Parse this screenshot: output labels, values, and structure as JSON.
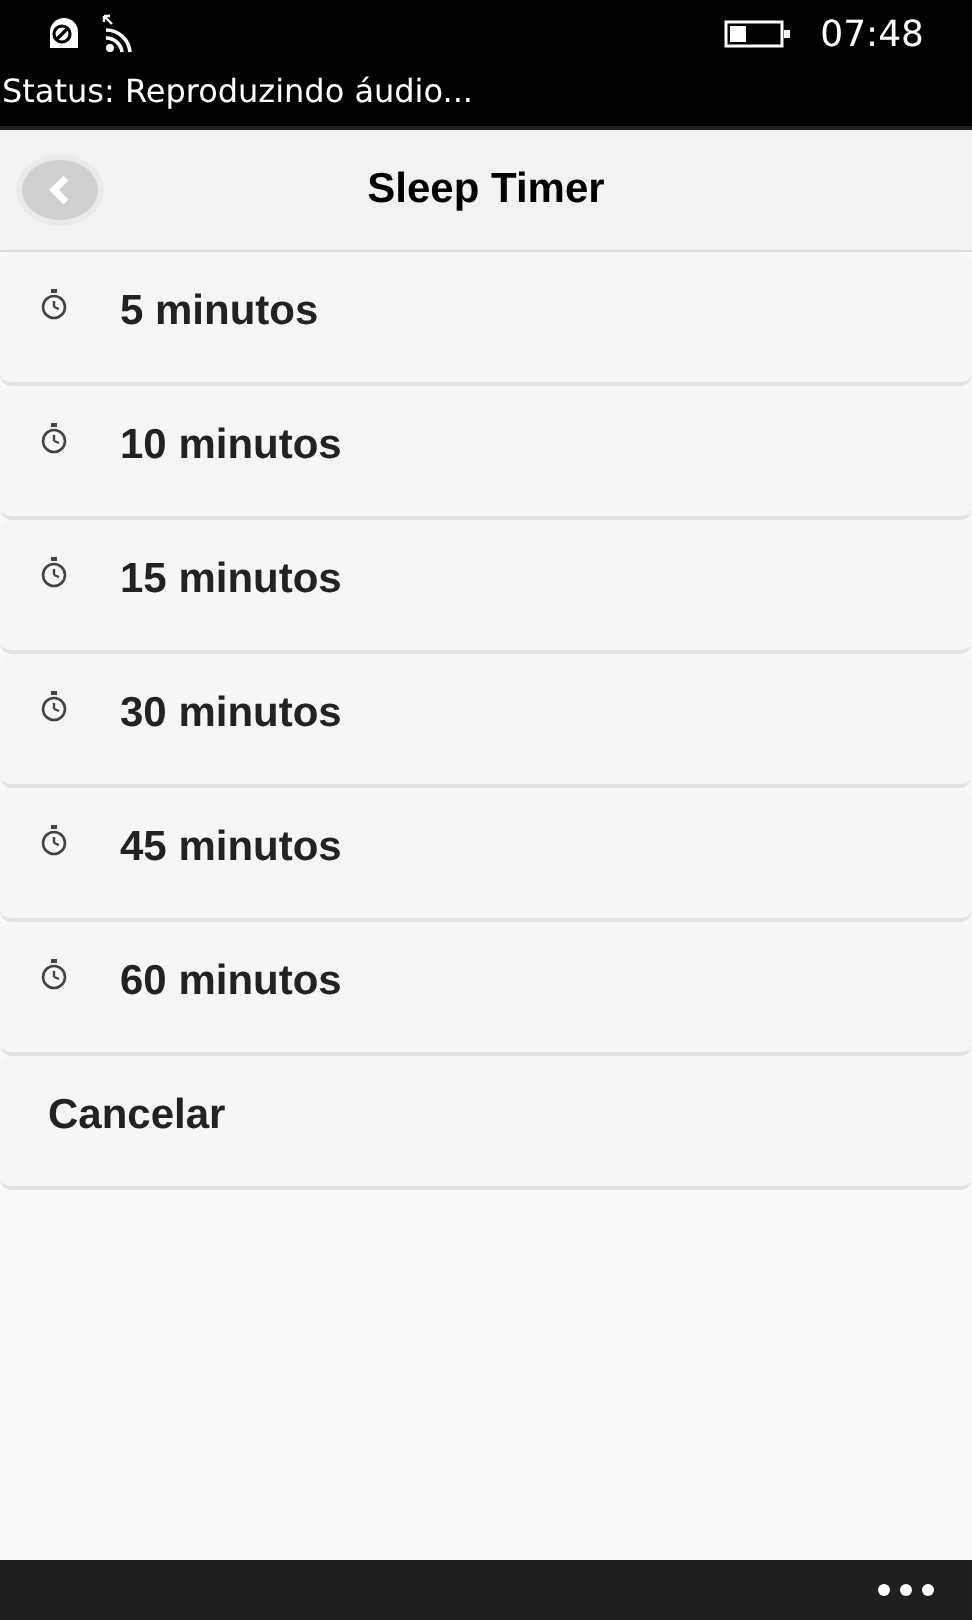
{
  "status_bar": {
    "time": "07:48",
    "status_text": "Status: Reproduzindo áudio..."
  },
  "header": {
    "title": "Sleep Timer"
  },
  "items": [
    {
      "label": "5 minutos",
      "kind": "timer"
    },
    {
      "label": "10 minutos",
      "kind": "timer"
    },
    {
      "label": "15 minutos",
      "kind": "timer"
    },
    {
      "label": "30 minutos",
      "kind": "timer"
    },
    {
      "label": "45 minutos",
      "kind": "timer"
    },
    {
      "label": "60 minutos",
      "kind": "timer"
    },
    {
      "label": "Cancelar",
      "kind": "plain"
    }
  ]
}
